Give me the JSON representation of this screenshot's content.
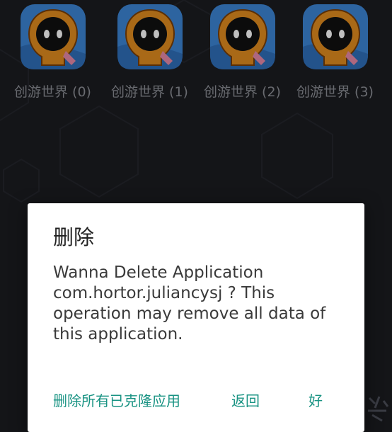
{
  "apps": [
    {
      "label": "创游世界 (0)",
      "icon": "hortor-robot-icon"
    },
    {
      "label": "创游世界 (1)",
      "icon": "hortor-robot-icon"
    },
    {
      "label": "创游世界 (2)",
      "icon": "hortor-robot-icon"
    },
    {
      "label": "创游世界 (3)",
      "icon": "hortor-robot-icon"
    }
  ],
  "dialog": {
    "title": "删除",
    "message": "Wanna Delete Application com.hortor.juliancysj ? This operation may remove all data of this application.",
    "actions": {
      "delete_all": "删除所有已克隆应用",
      "back": "返回",
      "ok": "好"
    }
  },
  "colors": {
    "background": "#1b1c21",
    "accent": "#199383",
    "icon_bg": "#3d86d6",
    "robot_orange": "#e28c1f"
  }
}
